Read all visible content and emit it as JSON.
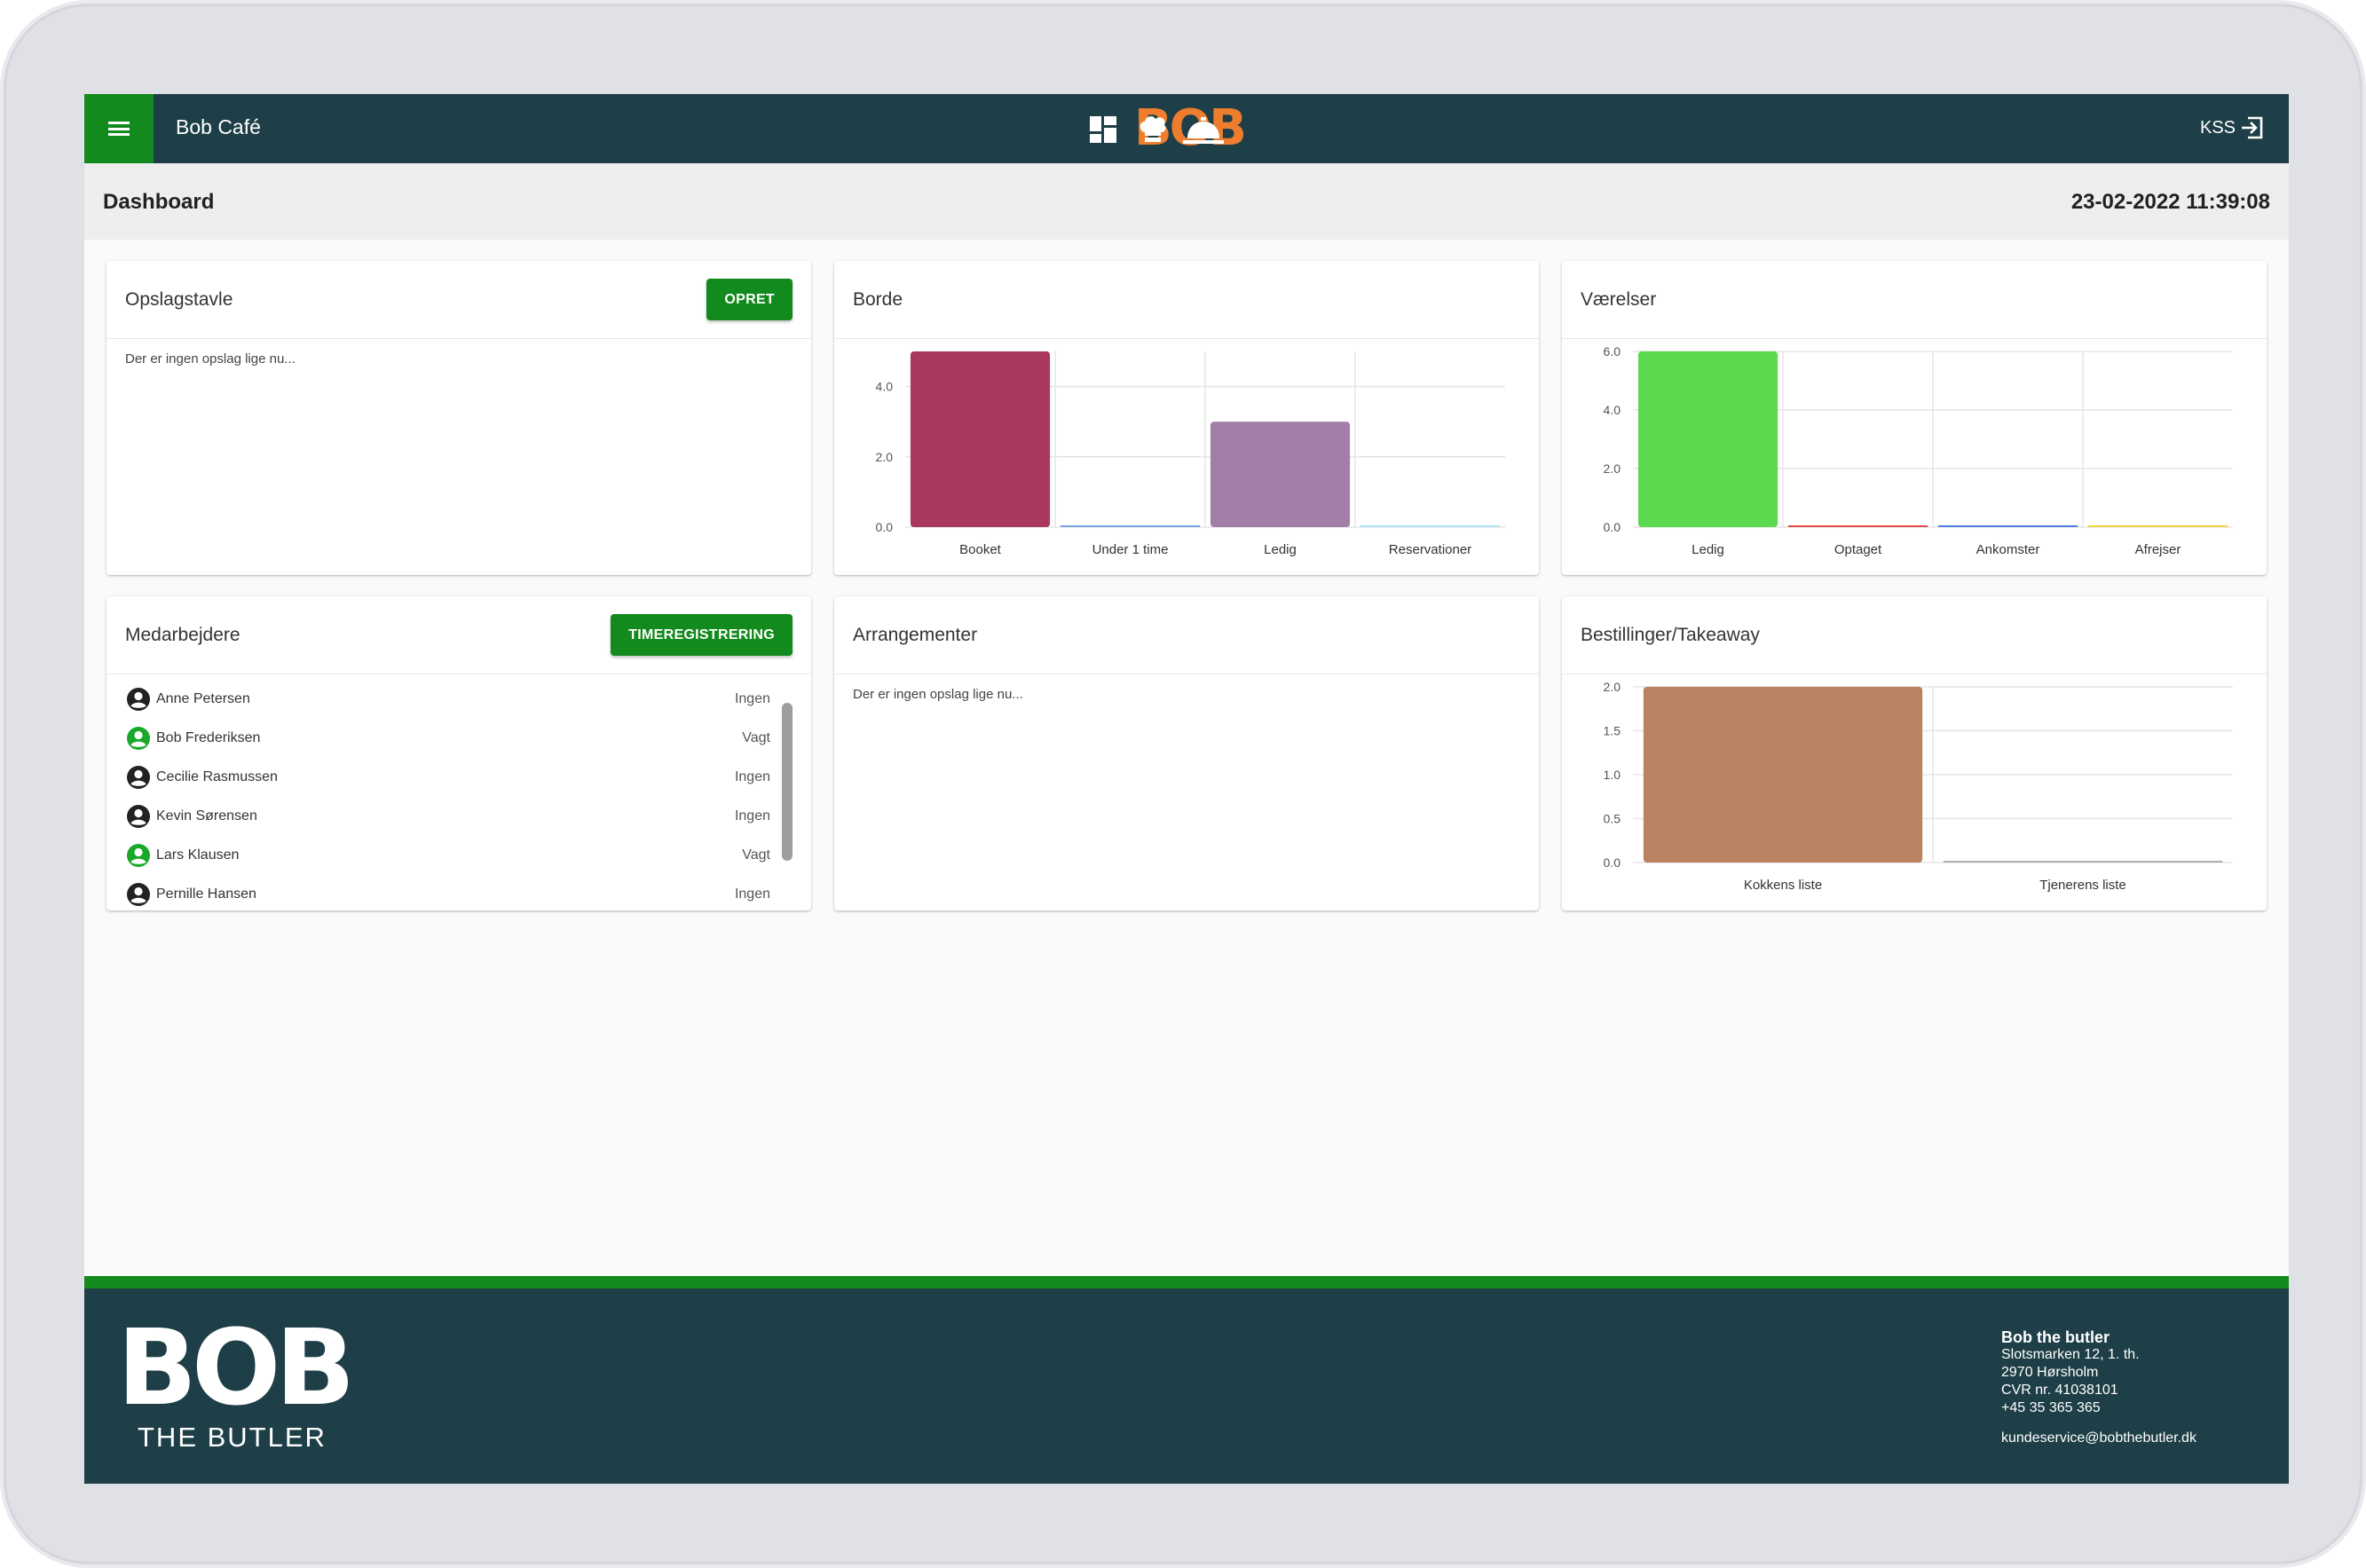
{
  "header": {
    "cafe_name": "Bob Café",
    "brand": "BOB",
    "user_code": "KSS",
    "icons": [
      "dashboard-icon",
      "chef-hat-icon",
      "service-bell-icon",
      "logout-icon"
    ]
  },
  "subheader": {
    "title": "Dashboard",
    "datetime": "23-02-2022 11:39:08"
  },
  "cards": {
    "bulletin": {
      "title": "Opslagstavle",
      "button": "OPRET",
      "empty_text": "Der er ingen opslag lige nu..."
    },
    "tables": {
      "title": "Borde"
    },
    "rooms": {
      "title": "Værelser"
    },
    "staff": {
      "title": "Medarbejdere",
      "button": "TIMEREGISTRERING",
      "employees": [
        {
          "name": "Anne Petersen",
          "status": "Ingen",
          "on_shift": false
        },
        {
          "name": "Bob Frederiksen",
          "status": "Vagt",
          "on_shift": true
        },
        {
          "name": "Cecilie Rasmussen",
          "status": "Ingen",
          "on_shift": false
        },
        {
          "name": "Kevin Sørensen",
          "status": "Ingen",
          "on_shift": false
        },
        {
          "name": "Lars Klausen",
          "status": "Vagt",
          "on_shift": true
        },
        {
          "name": "Pernille Hansen",
          "status": "Ingen",
          "on_shift": false
        }
      ]
    },
    "events": {
      "title": "Arrangementer",
      "empty_text": "Der er ingen opslag lige nu..."
    },
    "orders": {
      "title": "Bestillinger/Takeaway"
    }
  },
  "chart_data": [
    {
      "id": "borde",
      "type": "bar",
      "categories": [
        "Booket",
        "Under 1 time",
        "Ledig",
        "Reservationer"
      ],
      "values": [
        5,
        0,
        3,
        0
      ],
      "colors": [
        "#a8385d",
        "#7aa3e5",
        "#a27ea8",
        "#aae3f5"
      ],
      "yticks": [
        "0.0",
        "2.0",
        "4.0"
      ],
      "ylim": [
        0,
        5
      ],
      "grid": true
    },
    {
      "id": "vaerelser",
      "type": "bar",
      "categories": [
        "Ledig",
        "Optaget",
        "Ankomster",
        "Afrejser"
      ],
      "values": [
        6,
        0,
        0,
        0
      ],
      "colors": [
        "#5ad94f",
        "#e44d4d",
        "#4d7fe4",
        "#f5d33c"
      ],
      "yticks": [
        "0.0",
        "2.0",
        "4.0",
        "6.0"
      ],
      "ylim": [
        0,
        6
      ],
      "grid": true
    },
    {
      "id": "bestillinger",
      "type": "bar",
      "categories": [
        "Kokkens liste",
        "Tjenerens liste"
      ],
      "values": [
        2,
        0
      ],
      "colors": [
        "#b98361",
        "#b0b0b0"
      ],
      "yticks": [
        "0.0",
        "0.5",
        "1.0",
        "1.5",
        "2.0"
      ],
      "ylim": [
        0,
        2
      ],
      "grid": true
    }
  ],
  "footer": {
    "logo": "BOB",
    "tagline": "THE BUTLER",
    "company_name": "Bob the butler",
    "address_line1": "Slotsmarken 12, 1. th.",
    "address_line2": "2970 Hørsholm",
    "cvr": "CVR nr. 41038101",
    "phone": "+45 35 365 365",
    "email": "kundeservice@bobthebutler.dk",
    "colors": {
      "bar": "#1e3f47",
      "stripe": "#138a1d",
      "brand_orange": "#ee7e2e"
    }
  }
}
